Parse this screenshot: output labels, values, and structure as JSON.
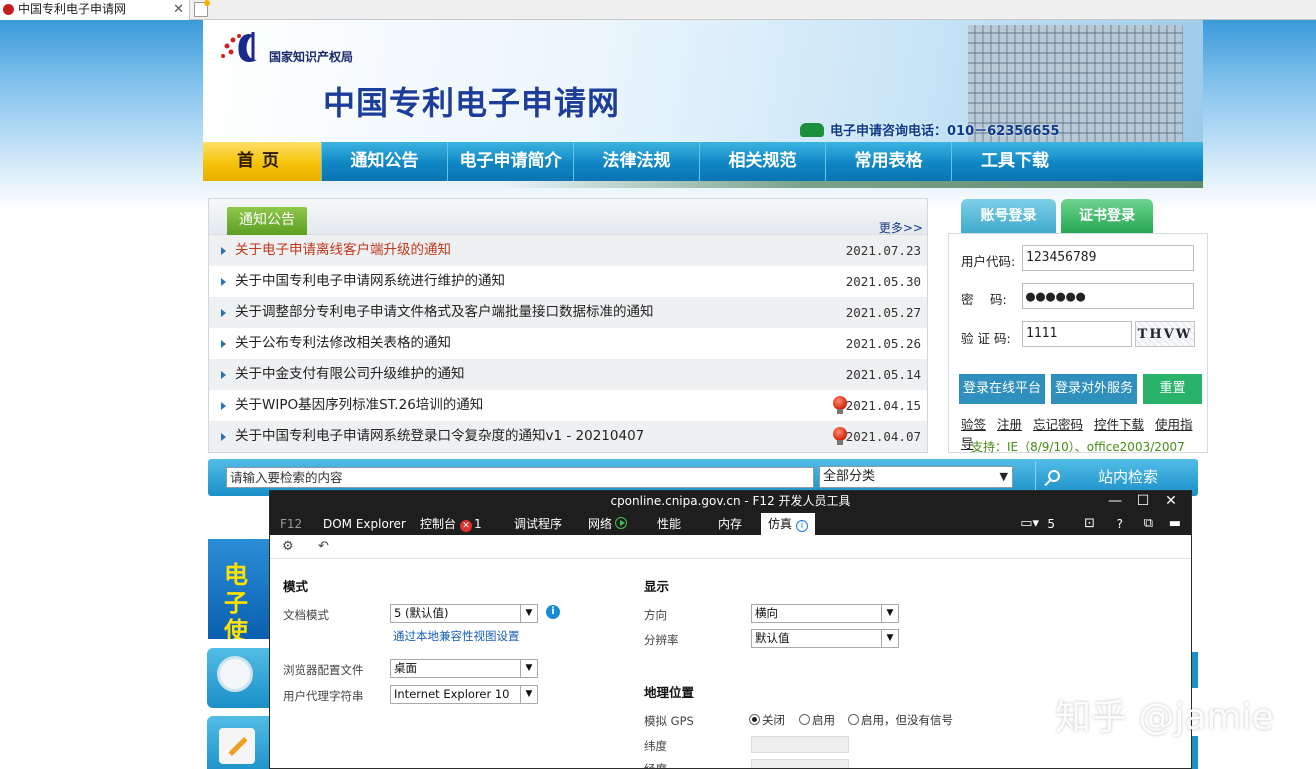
{
  "browser": {
    "tab_title": "中国专利电子申请网",
    "tab_close": "✕"
  },
  "header": {
    "agency": "国家知识产权局",
    "site_title": "中国专利电子申请网",
    "hotline": "电子申请咨询电话：010－62356655"
  },
  "nav": {
    "items": [
      "首页",
      "通知公告",
      "电子申请简介",
      "法律法规",
      "相关规范",
      "常用表格",
      "工具下载"
    ]
  },
  "notices": {
    "tab": "通知公告",
    "more": "更多>>",
    "items": [
      {
        "title": "关于电子申请离线客户端升级的通知",
        "date": "2021.07.23",
        "hot": true,
        "new": false
      },
      {
        "title": "关于中国专利电子申请网系统进行维护的通知",
        "date": "2021.05.30",
        "hot": false,
        "new": false
      },
      {
        "title": "关于调整部分专利电子申请文件格式及客户端批量接口数据标准的通知",
        "date": "2021.05.27",
        "hot": false,
        "new": false
      },
      {
        "title": "关于公布专利法修改相关表格的通知",
        "date": "2021.05.26",
        "hot": false,
        "new": false
      },
      {
        "title": "关于中金支付有限公司升级维护的通知",
        "date": "2021.05.14",
        "hot": false,
        "new": false
      },
      {
        "title": "关于WIPO基因序列标准ST.26培训的通知",
        "date": "2021.04.15",
        "hot": false,
        "new": true
      },
      {
        "title": "关于中国专利电子申请网系统登录口令复杂度的通知v1 - 20210407",
        "date": "2021.04.07",
        "hot": false,
        "new": true
      }
    ]
  },
  "login": {
    "tab_account": "账号登录",
    "tab_cert": "证书登录",
    "user_label": "用户代码:",
    "user_value": "123456789",
    "pass_label": "密　 码:",
    "pass_value": "●●●●●●",
    "captcha_label": "验 证 码:",
    "captcha_value": "1111",
    "captcha_image_text": "THVW",
    "btn_online": "登录在线平台",
    "btn_external": "登录对外服务",
    "btn_reset": "重置",
    "links": [
      "验签",
      "注册",
      "忘记密码",
      "控件下载",
      "使用指导"
    ],
    "support": "支持：IE（8/9/10）、office2003/2007"
  },
  "search": {
    "placeholder": "请输入要检索的内容",
    "category": "全部分类",
    "button": "站内检索"
  },
  "promo": {
    "text": "电子使用"
  },
  "devtools": {
    "title": "cponline.cnipa.gov.cn - F12 开发人员工具",
    "window_buttons": [
      "—",
      "☐",
      "✕"
    ],
    "tabs": [
      "F12",
      "DOM Explorer",
      "控制台",
      "调试程序",
      "网络",
      "性能",
      "内存",
      "仿真"
    ],
    "error_count": "1",
    "active_tab": "仿真",
    "right_count": "5",
    "right_icons": [
      "?"
    ],
    "mode": {
      "heading": "模式",
      "doc_mode_label": "文档模式",
      "doc_mode_value": "5 (默认值)",
      "compat_link": "通过本地兼容性视图设置",
      "profile_label": "浏览器配置文件",
      "profile_value": "桌面",
      "ua_label": "用户代理字符串",
      "ua_value": "Internet Explorer 10"
    },
    "display": {
      "heading": "显示",
      "orientation_label": "方向",
      "orientation_value": "横向",
      "resolution_label": "分辨率",
      "resolution_value": "默认值"
    },
    "geo": {
      "heading": "地理位置",
      "gps_label": "模拟 GPS",
      "options": [
        "关闭",
        "启用",
        "启用，但没有信号"
      ],
      "selected": 0,
      "lat_label": "纬度",
      "lon_label": "经度"
    }
  },
  "watermark": "知乎 @jamie"
}
